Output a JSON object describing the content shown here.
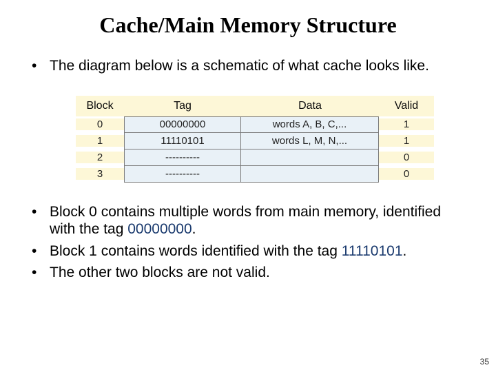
{
  "title": "Cache/Main Memory Structure",
  "intro_bullet": "The diagram below is a schematic of what cache looks like.",
  "headers": {
    "block": "Block",
    "tag": "Tag",
    "data": "Data",
    "valid": "Valid"
  },
  "rows": [
    {
      "block": "0",
      "tag": "00000000",
      "data": "words A, B, C,...",
      "valid": "1"
    },
    {
      "block": "1",
      "tag": "11110101",
      "data": "words L, M, N,...",
      "valid": "1"
    },
    {
      "block": "2",
      "tag": "----------",
      "data": "",
      "valid": "0"
    },
    {
      "block": "3",
      "tag": "----------",
      "data": "",
      "valid": "0"
    }
  ],
  "bullets": {
    "b0a": "Block 0 contains multiple words from main memory, identified with the tag ",
    "b0tag": "00000000",
    "b0b": ".",
    "b1a": "Block 1 contains words identified with the tag ",
    "b1tag": "11110101",
    "b1b": ".",
    "b2": "The other two blocks are not valid."
  },
  "slide_number": "35"
}
